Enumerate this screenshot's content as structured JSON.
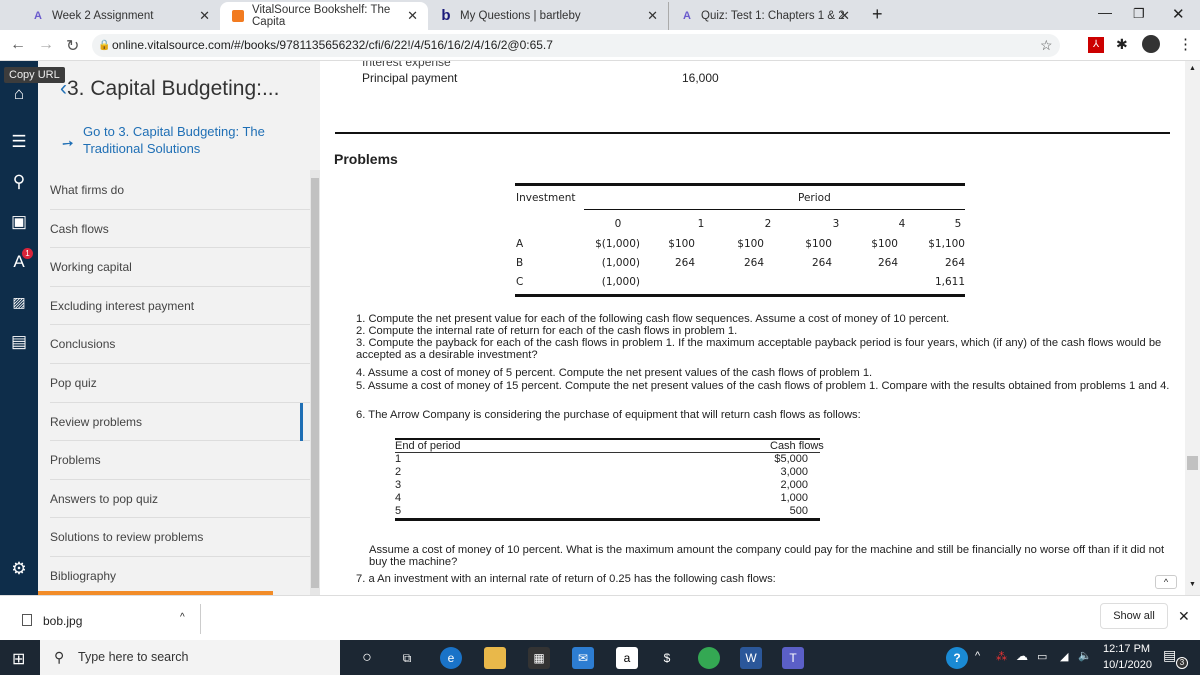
{
  "browser": {
    "tabs": [
      {
        "title": "Week 2 Assignment",
        "icon": "au-logo-icon"
      },
      {
        "title": "VitalSource Bookshelf: The Capita",
        "icon": "vitalsource-icon",
        "active": true
      },
      {
        "title": "My Questions | bartleby",
        "icon": "bartleby-b-icon"
      },
      {
        "title": "Quiz: Test 1: Chapters 1 & 2",
        "icon": "au-logo-icon"
      }
    ],
    "url": "online.vitalsource.com/#/books/9781135656232/cfi/6/22!/4/516/16/2/4/16/2@0:65.7"
  },
  "reader": {
    "tooltip": "Copy URL",
    "chapter_title": "3. Capital Budgeting:...",
    "goto_link": "Go to 3. Capital Budgeting: The Traditional Solutions",
    "toc": [
      "What firms do",
      "Cash flows",
      "Working capital",
      "Excluding interest payment",
      "Conclusions",
      "Pop quiz",
      "Review problems",
      "Problems",
      "Answers to pop quiz",
      "Solutions to review problems",
      "Bibliography"
    ],
    "selected_toc": "Review problems",
    "notification_badge": "1",
    "accent": "#1f6fb5"
  },
  "content": {
    "cut_off_label": "Interest expense",
    "principal_label": "Principal payment",
    "principal_value": "16,000",
    "section_heading": "Problems",
    "table1": {
      "col_investment": "Investment",
      "col_period": "Period",
      "periods": [
        "0",
        "1",
        "2",
        "3",
        "4",
        "5"
      ],
      "rows": [
        {
          "name": "A",
          "values": [
            "$(1,000)",
            "$100",
            "$100",
            "$100",
            "$100",
            "$1,100"
          ]
        },
        {
          "name": "B",
          "values": [
            "(1,000)",
            "264",
            "264",
            "264",
            "264",
            "264"
          ]
        },
        {
          "name": "C",
          "values": [
            "(1,000)",
            "",
            "",
            "",
            "",
            "1,611"
          ]
        }
      ]
    },
    "problems": [
      "1. Compute the net present value for each of the following cash flow sequences. Assume a cost of money of 10 percent.",
      "2. Compute the internal rate of return for each of the cash flows in problem 1.",
      "3. Compute the payback for each of the cash flows in problem 1. If the maximum acceptable payback period is four years, which (if any) of the cash flows would be accepted as a desirable investment?",
      "4. Assume a cost of money of 5 percent. Compute the net present values of the cash flows of problem 1.",
      "5. Assume a cost of money of 15 percent. Compute the net present values of the cash flows of problem 1. Compare with the results obtained from problems 1 and 4.",
      "6. The Arrow Company is considering the purchase of equipment that will return cash flows as follows:"
    ],
    "table2": {
      "col_period": "End of period",
      "col_cash": "Cash flows",
      "rows": [
        [
          "1",
          "$5,000"
        ],
        [
          "2",
          "3,000"
        ],
        [
          "3",
          "2,000"
        ],
        [
          "4",
          "1,000"
        ],
        [
          "5",
          "500"
        ]
      ]
    },
    "after_table": "Assume a cost of money of 10 percent. What is the maximum amount the company could pay for the machine and still be financially no worse off than if it did not buy the machine?",
    "problem7": "7. a An investment with an internal rate of return of 0.25 has the following cash flows:"
  },
  "downloads": {
    "file": "bob.jpg",
    "show_all": "Show all"
  },
  "taskbar": {
    "search_placeholder": "Type here to search",
    "time": "12:17 PM",
    "date": "10/1/2020",
    "notifications": "3"
  }
}
